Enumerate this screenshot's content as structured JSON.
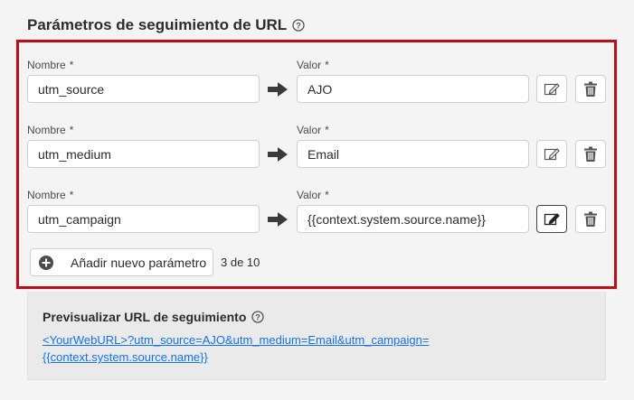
{
  "section": {
    "title": "Parámetros de seguimiento de URL"
  },
  "labels": {
    "name": "Nombre",
    "value": "Valor",
    "required": "*"
  },
  "params": [
    {
      "name": "utm_source",
      "value": "AJO"
    },
    {
      "name": "utm_medium",
      "value": "Email"
    },
    {
      "name": "utm_campaign",
      "value": "{{context.system.source.name}}"
    }
  ],
  "add_button": {
    "label": "Añadir nuevo parámetro"
  },
  "count": "3 de 10",
  "preview": {
    "title": "Previsualizar URL de seguimiento",
    "url_line1": "<YourWebURL>?utm_source=AJO&utm_medium=Email&utm_campaign=",
    "url_line2": "{{context.system.source.name}}"
  },
  "colors": {
    "highlight_border": "#b3121b",
    "link": "#1473e6"
  }
}
